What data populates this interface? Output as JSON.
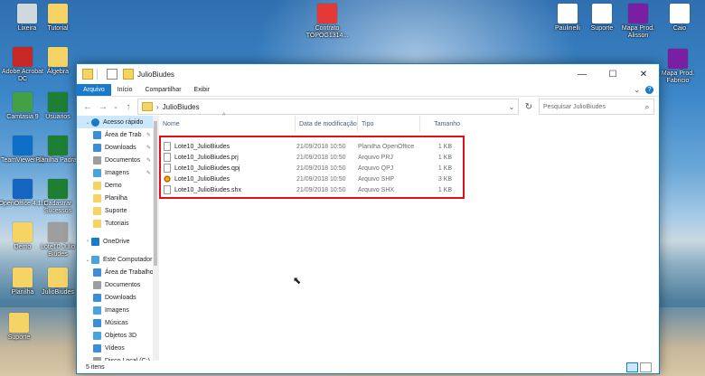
{
  "desktop": {
    "icons": [
      {
        "label": "Lixeira",
        "color": "#cfd8dc"
      },
      {
        "label": "Tutorial",
        "color": "#f6d365"
      },
      {
        "label": "Adobe Acrobat DC",
        "color": "#c62828"
      },
      {
        "label": "Álgebra",
        "color": "#f6d365"
      },
      {
        "label": "Camtasia 9",
        "color": "#43a047"
      },
      {
        "label": "Usuarios",
        "color": "#1e7e34"
      },
      {
        "label": "TeamViewer 13",
        "color": "#0e6fc7"
      },
      {
        "label": "Planilha Padrao",
        "color": "#1e7e34"
      },
      {
        "label": "OpenOffice 4.1.1",
        "color": "#1565c0"
      },
      {
        "label": "Cadastrar Sucessos",
        "color": "#1e7e34"
      },
      {
        "label": "Demo",
        "color": "#f6d365"
      },
      {
        "label": "Lote10 Julio Biudes",
        "color": "#9e9e9e"
      },
      {
        "label": "Planilha",
        "color": "#f6d365"
      },
      {
        "label": "JulioBiudes",
        "color": "#f6d365"
      },
      {
        "label": "Suporte",
        "color": "#f6d365"
      },
      {
        "label": "Contrato TOPOG1314...",
        "color": "#e53935"
      },
      {
        "label": "Paulinelli",
        "color": "#ffffff"
      },
      {
        "label": "Suporte",
        "color": "#ffffff"
      },
      {
        "label": "Mapa Prod. Alisson",
        "color": "#7b1fa2"
      },
      {
        "label": "Caio",
        "color": "#ffffff"
      },
      {
        "label": "Mapa Prod. Fabricio",
        "color": "#7b1fa2"
      }
    ]
  },
  "window": {
    "title": "JulioBiudes",
    "controls": {
      "minimize": "—",
      "maximize": "☐",
      "close": "✕"
    },
    "ribbon_tabs": [
      "Arquivo",
      "Início",
      "Compartilhar",
      "Exibir"
    ],
    "ribbon_right": {
      "expand": "⌄",
      "help": "?"
    },
    "address": {
      "separator": "›",
      "path": "JulioBiudes"
    },
    "search_placeholder": "Pesquisar JulioBiudes",
    "nav": [
      {
        "label": "Acesso rápido",
        "level": 1,
        "icon": "star-icon",
        "color": "#1979ca",
        "expanded": true,
        "selected": true
      },
      {
        "label": "Área de Trab",
        "level": 2,
        "icon": "desktop-icon",
        "color": "#3b8ed8",
        "pinned": true
      },
      {
        "label": "Downloads",
        "level": 2,
        "icon": "download-icon",
        "color": "#3b8ed8",
        "pinned": true
      },
      {
        "label": "Documentos",
        "level": 2,
        "icon": "documents-icon",
        "color": "#9e9e9e",
        "pinned": true
      },
      {
        "label": "Imagens",
        "level": 2,
        "icon": "images-icon",
        "color": "#4aa3df",
        "pinned": true
      },
      {
        "label": "Demo",
        "level": 2,
        "icon": "folder-icon",
        "color": "#f6d365"
      },
      {
        "label": "Planilha",
        "level": 2,
        "icon": "folder-icon",
        "color": "#f6d365"
      },
      {
        "label": "Suporte",
        "level": 2,
        "icon": "folder-icon",
        "color": "#f6d365"
      },
      {
        "label": "Tutoriais",
        "level": 2,
        "icon": "folder-icon",
        "color": "#f6d365"
      },
      {
        "label": "",
        "level": 0,
        "spacer": true
      },
      {
        "label": "OneDrive",
        "level": 1,
        "icon": "onedrive-icon",
        "color": "#1979ca"
      },
      {
        "label": "",
        "level": 0,
        "spacer": true
      },
      {
        "label": "Este Computador",
        "level": 1,
        "icon": "computer-icon",
        "color": "#4aa3df",
        "expanded": true
      },
      {
        "label": "Área de Trabalho",
        "level": 2,
        "icon": "desktop-icon",
        "color": "#3b8ed8"
      },
      {
        "label": "Documentos",
        "level": 2,
        "icon": "documents-icon",
        "color": "#9e9e9e"
      },
      {
        "label": "Downloads",
        "level": 2,
        "icon": "download-icon",
        "color": "#3b8ed8"
      },
      {
        "label": "Imagens",
        "level": 2,
        "icon": "images-icon",
        "color": "#4aa3df"
      },
      {
        "label": "Músicas",
        "level": 2,
        "icon": "music-icon",
        "color": "#3b8ed8"
      },
      {
        "label": "Objetos 3D",
        "level": 2,
        "icon": "objects3d-icon",
        "color": "#4aa3df"
      },
      {
        "label": "Vídeos",
        "level": 2,
        "icon": "videos-icon",
        "color": "#3b8ed8"
      },
      {
        "label": "Disco Local (C:)",
        "level": 2,
        "icon": "drive-icon",
        "color": "#9e9e9e"
      }
    ],
    "columns": {
      "name": "Nome",
      "date": "Data de modificação",
      "type": "Tipo",
      "size": "Tamanho"
    },
    "files": [
      {
        "name": "Lote10_JulioBiudes",
        "date": "21/09/2018 10:50",
        "type": "Planilha OpenOffice",
        "size": "1 KB",
        "icon": "sheet"
      },
      {
        "name": "Lote10_JulioBiudes.prj",
        "date": "21/09/2018 10:50",
        "type": "Arquivo PRJ",
        "size": "1 KB",
        "icon": "file"
      },
      {
        "name": "Lote10_JulioBiudes.qpj",
        "date": "21/09/2018 10:50",
        "type": "Arquivo QPJ",
        "size": "1 KB",
        "icon": "file"
      },
      {
        "name": "Lote10_JulioBiudes",
        "date": "21/09/2018 10:50",
        "type": "Arquivo SHP",
        "size": "3 KB",
        "icon": "shp"
      },
      {
        "name": "Lote10_JulioBiudes.shx",
        "date": "21/09/2018 10:50",
        "type": "Arquivo SHX",
        "size": "1 KB",
        "icon": "file"
      }
    ],
    "status": "5 itens",
    "highlight_color": "#e0101a",
    "accent_color": "#1979ca"
  }
}
